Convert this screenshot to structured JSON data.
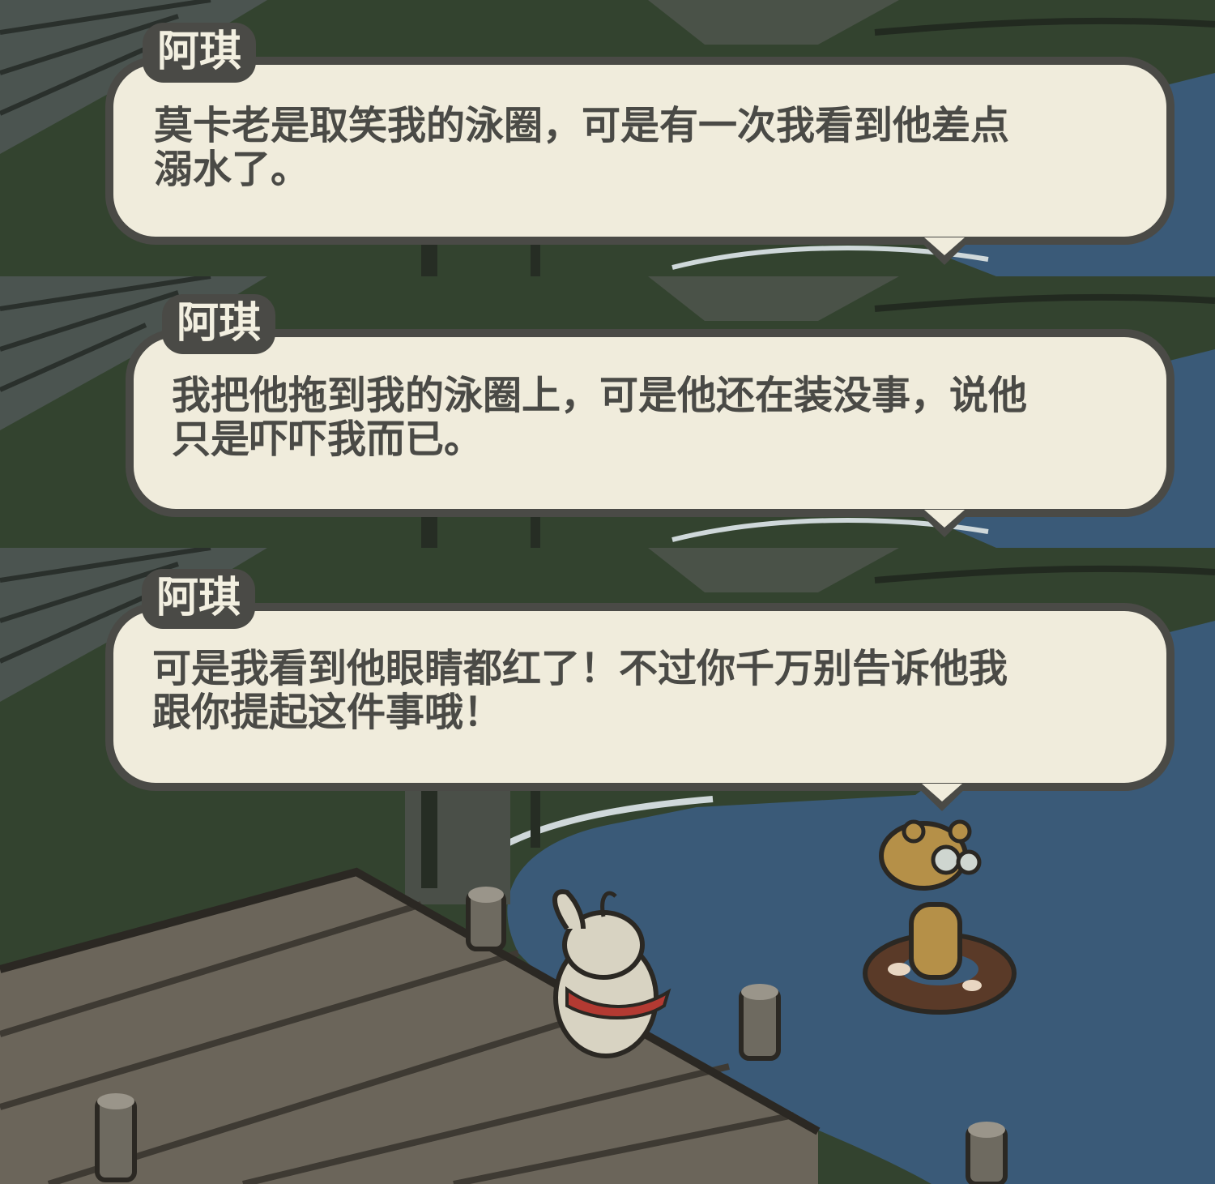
{
  "dialogs": [
    {
      "speaker": "阿琪",
      "line1": "莫卡老是取笑我的泳圈，可是有一次我看到他差点",
      "line2": "溺水了。"
    },
    {
      "speaker": "阿琪",
      "line1": "我把他拖到我的泳圈上，可是他还在装没事，说他",
      "line2": "只是吓吓我而已。"
    },
    {
      "speaker": "阿琪",
      "line1": "可是我看到他眼睛都红了！不过你千万别告诉他我",
      "line2": "跟你提起这件事哦！"
    }
  ],
  "colors": {
    "grass": "#33432f",
    "water": "#3a5a78",
    "dock": "#6b655a",
    "bubble_fill": "#f0ecdc",
    "bubble_border": "#4a4a46",
    "tag_fill": "#4a4a46",
    "tag_text": "#f2efe0"
  },
  "scene": {
    "characters": [
      "rabbit-with-red-scarf",
      "giraffe-in-swim-ring"
    ]
  }
}
